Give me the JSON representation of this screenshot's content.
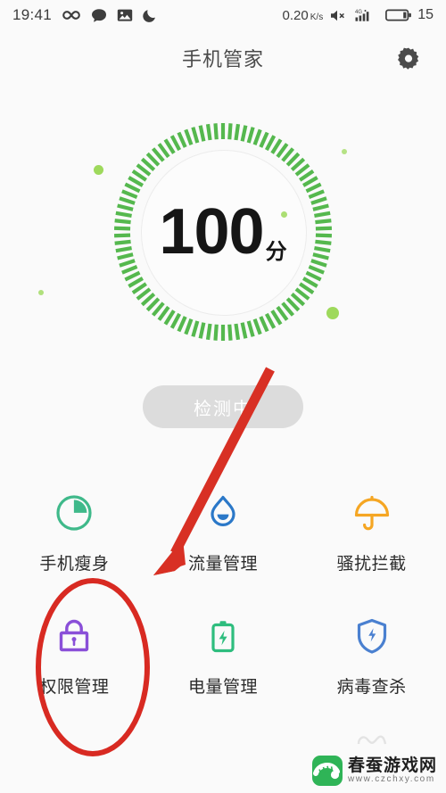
{
  "statusbar": {
    "time": "19:41",
    "icons_left": [
      "infinity-icon",
      "message-bubble-icon",
      "photo-icon",
      "do-not-disturb-moon-icon"
    ],
    "network_speed": "0.20",
    "network_speed_unit": "K/s",
    "mute_icon": "speaker-muted-icon",
    "signal_label": "4G",
    "signal_icon": "signal-bars-icon",
    "battery_icon": "battery-icon",
    "battery_level": "15"
  },
  "header": {
    "title": "手机管家",
    "settings_icon": "gear-icon"
  },
  "dial": {
    "score": "100",
    "unit": "分",
    "tick_color": "#55b84e",
    "tick_count": 90,
    "dot_color": "#9ed95c"
  },
  "action": {
    "label": "检测中"
  },
  "grid": {
    "items": [
      {
        "label": "手机瘦身",
        "icon": "pie-chart-icon",
        "color": "#3fb98a"
      },
      {
        "label": "流量管理",
        "icon": "water-drop-icon",
        "color": "#2b78c8"
      },
      {
        "label": "骚扰拦截",
        "icon": "umbrella-icon",
        "color": "#f5a623"
      },
      {
        "label": "权限管理",
        "icon": "lock-icon",
        "color": "#8a4fd8"
      },
      {
        "label": "电量管理",
        "icon": "battery-bolt-icon",
        "color": "#2ebd7e"
      },
      {
        "label": "病毒查杀",
        "icon": "shield-bolt-icon",
        "color": "#4a80d0"
      }
    ]
  },
  "annotations": {
    "arrow_color": "#d83024",
    "ellipse_color": "#d82a22",
    "arrow_name": "red-pointer-arrow",
    "ellipse_name": "red-highlight-ellipse",
    "highlighted_item": "权限管理"
  },
  "watermark": {
    "title": "春蚕游戏网",
    "url": "www.czchxy.com",
    "logo_icon": "silkworm-logo-icon"
  }
}
